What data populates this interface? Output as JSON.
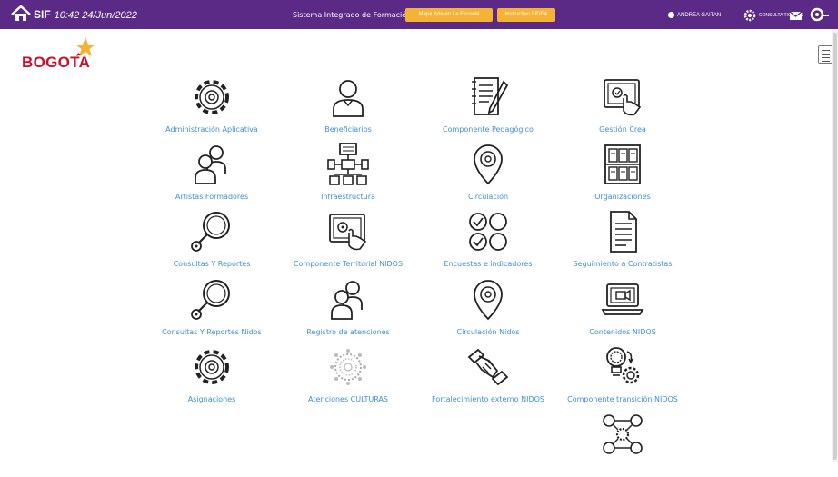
{
  "header": {
    "app_name": "SIF",
    "datetime": "10:42 24/Jun/2022",
    "system_title": "Sistema Integrado de Formación",
    "button_primary": "Mapa Arte en La Escuela",
    "button_secondary": "Instructivo SIDEA",
    "user_name": "ANDREA GAITAN",
    "settings_text": "CONSULTA TICKETS",
    "color_bar": "#5b2a86",
    "color_button": "#f5b335"
  },
  "logo": {
    "text": "BOGOTA",
    "icon": "star-logo-icon"
  },
  "tiles": [
    {
      "label": "Administración Aplicativa",
      "icon": "gear-icon"
    },
    {
      "label": "Beneficiarios",
      "icon": "person-icon"
    },
    {
      "label": "Componente Pedagógico",
      "icon": "notebook-pencil-icon"
    },
    {
      "label": "Gestión Crea",
      "icon": "tablet-touch-icon"
    },
    {
      "label": "Artistas Formadores",
      "icon": "people-icon"
    },
    {
      "label": "Infraestructura",
      "icon": "org-chart-icon"
    },
    {
      "label": "Circulación",
      "icon": "location-pin-icon"
    },
    {
      "label": "Organizaciones",
      "icon": "building-icon"
    },
    {
      "label": "Consultas Y Reportes",
      "icon": "magnifier-icon"
    },
    {
      "label": "Componente Territorial NIDOS",
      "icon": "tablet-touch-icon"
    },
    {
      "label": "Encuestas e indicadores",
      "icon": "check-circles-icon"
    },
    {
      "label": "Seguimiento a Contratistas",
      "icon": "document-icon"
    },
    {
      "label": "Consultas Y Reportes Nidos",
      "icon": "magnifier-icon"
    },
    {
      "label": "Registro de atenciones",
      "icon": "people-icon"
    },
    {
      "label": "Circulación Nidos",
      "icon": "location-pin-icon"
    },
    {
      "label": "Contenidos NIDOS",
      "icon": "laptop-video-icon"
    },
    {
      "label": "Asignaciones",
      "icon": "gear-icon"
    },
    {
      "label": "Atenciones CULTURAS",
      "icon": "virus-icon"
    },
    {
      "label": "Fortalecimiento externo NIDOS",
      "icon": "handshake-icon"
    },
    {
      "label": "Componente transición NIDOS",
      "icon": "idea-gear-icon"
    },
    {
      "label": "",
      "icon": "network-people-icon"
    }
  ]
}
